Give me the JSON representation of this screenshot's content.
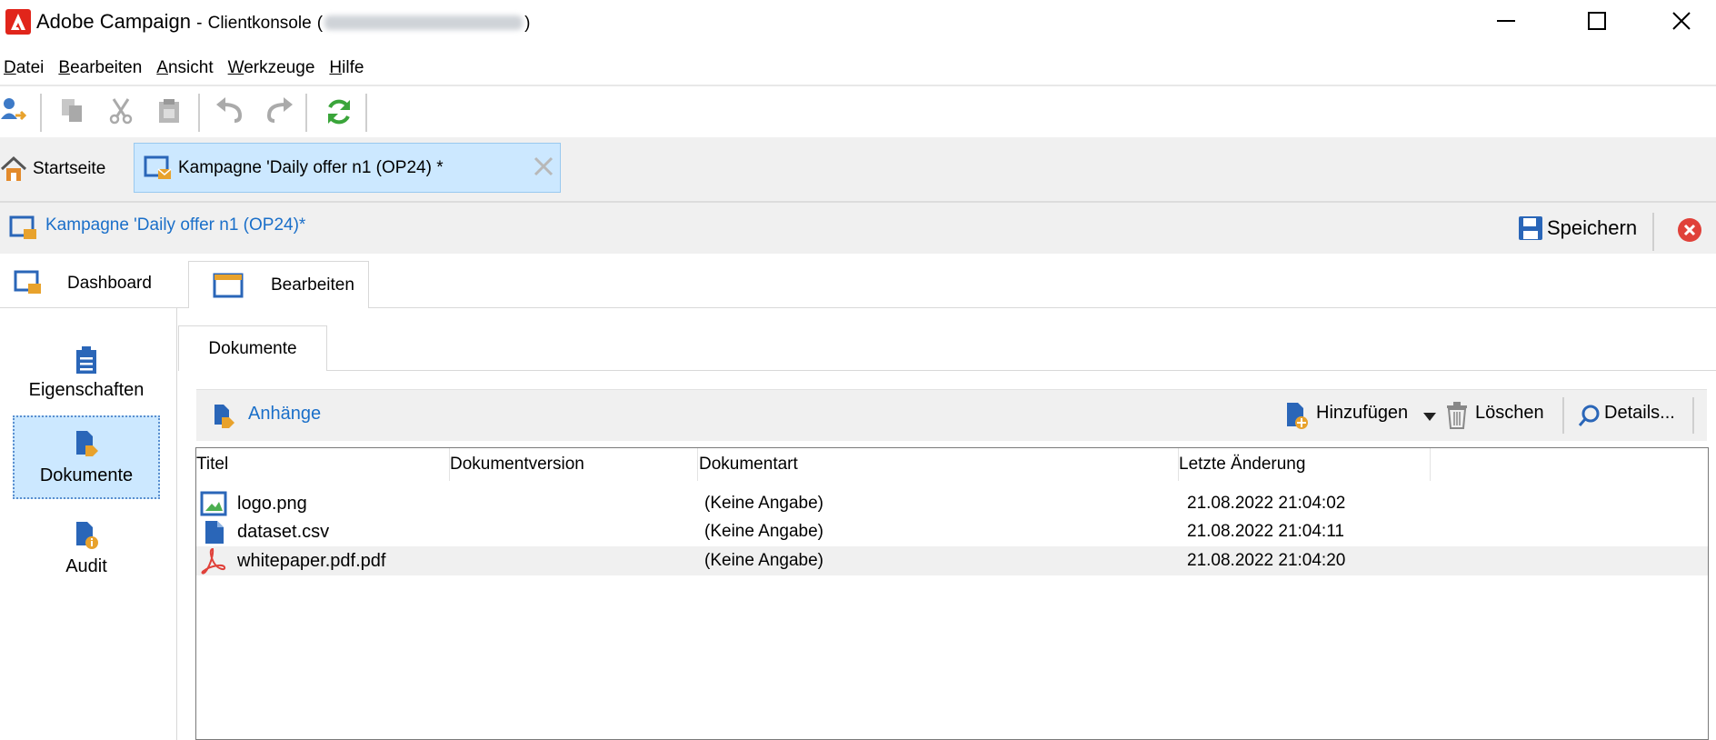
{
  "window": {
    "app_name": "Adobe Campaign",
    "separator": "-",
    "console_label": "Clientkonsole",
    "paren_open": "(",
    "paren_close": ")",
    "controls": {
      "minimize": "—",
      "maximize": "☐",
      "close": "✕"
    }
  },
  "menu": [
    {
      "key": "D",
      "rest": "atei"
    },
    {
      "key": "B",
      "rest": "earbeiten"
    },
    {
      "key": "A",
      "rest": "nsicht"
    },
    {
      "key": "W",
      "rest": "erkzeuge"
    },
    {
      "key": "H",
      "rest": "ilfe"
    }
  ],
  "toolbar": {
    "icons": [
      "logon-icon",
      "copy-icon",
      "cut-icon",
      "paste-icon",
      "undo-icon",
      "redo-icon",
      "refresh-icon"
    ]
  },
  "tabs": {
    "home_label": "Startseite",
    "campaign_label": "Kampagne 'Daily offer n1 (OP24) *",
    "close_glyph": "✕"
  },
  "header": {
    "title": "Kampagne 'Daily offer n1  (OP24)*",
    "save_label": "Speichern"
  },
  "view_tabs": {
    "dashboard": "Dashboard",
    "edit": "Bearbeiten"
  },
  "left_nav": {
    "properties": "Eigenschaften",
    "documents": "Dokumente",
    "audit": "Audit"
  },
  "content": {
    "tab": "Dokumente",
    "section_label": "Anhänge",
    "add_label": "Hinzufügen",
    "delete_label": "Löschen",
    "details_label": "Details..."
  },
  "grid": {
    "columns": [
      "Titel",
      "Dokumentversion",
      "Dokumentart",
      "Letzte Änderung"
    ],
    "rows": [
      {
        "title": "logo.png",
        "version": "",
        "type": "(Keine Angabe)",
        "modified": "21.08.2022 21:04:02",
        "icon": "image-file-icon"
      },
      {
        "title": "dataset.csv",
        "version": "",
        "type": "(Keine Angabe)",
        "modified": "21.08.2022 21:04:11",
        "icon": "document-file-icon"
      },
      {
        "title": "whitepaper.pdf.pdf",
        "version": "",
        "type": "(Keine Angabe)",
        "modified": "21.08.2022 21:04:20",
        "icon": "pdf-file-icon"
      }
    ]
  },
  "colors": {
    "accent_blue": "#1a6fc9",
    "selected_bg": "#cce8ff",
    "adobe_red": "#e1251b",
    "close_red": "#e0413a",
    "refresh_green": "#3aa53a"
  }
}
